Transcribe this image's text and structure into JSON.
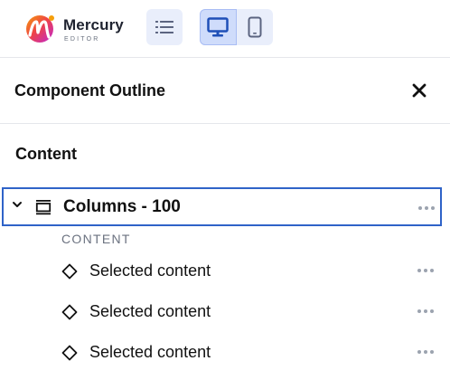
{
  "app": {
    "logo_text": "Mercury",
    "logo_subtext": "EDITOR",
    "brand_colors": {
      "primary": "#e11d74",
      "accent": "#f59e0b",
      "active_blue": "#2f63c8"
    }
  },
  "toolbar": {
    "outline_toggle_icon": "list-icon",
    "device_desktop_icon": "monitor-icon",
    "device_mobile_icon": "mobile-icon"
  },
  "panel": {
    "title": "Component Outline",
    "close_icon": "close-icon"
  },
  "outline": {
    "section_title": "Content",
    "parent": {
      "label": "Columns - 100",
      "icon": "columns-icon",
      "expanded": true
    },
    "group_label": "CONTENT",
    "children": [
      {
        "label": "Selected content",
        "icon": "diamond-icon"
      },
      {
        "label": "Selected content",
        "icon": "diamond-icon"
      },
      {
        "label": "Selected content",
        "icon": "diamond-icon"
      }
    ]
  }
}
